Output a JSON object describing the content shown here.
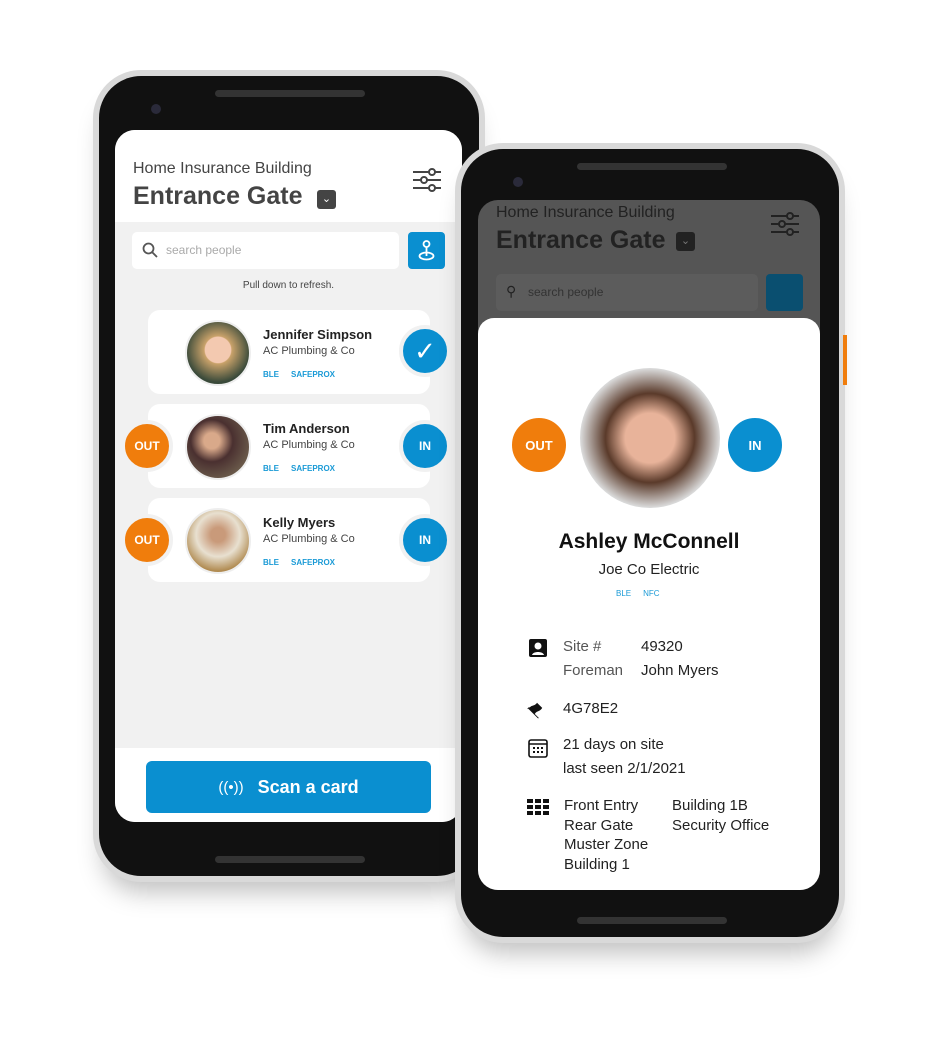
{
  "left_phone": {
    "header": {
      "subtitle": "Home Insurance Building",
      "title": "Entrance Gate"
    },
    "search": {
      "placeholder": "search people"
    },
    "refresh_hint": "Pull down to refresh.",
    "people": [
      {
        "name": "Jennifer Simpson",
        "company": "AC Plumbing & Co",
        "tags": [
          "BLE",
          "SAFEPROX"
        ],
        "status": "checked-in"
      },
      {
        "name": "Tim Anderson",
        "company": "AC Plumbing & Co",
        "tags": [
          "BLE",
          "SAFEPROX"
        ],
        "out_label": "OUT",
        "in_label": "IN"
      },
      {
        "name": "Kelly Myers",
        "company": "AC Plumbing & Co",
        "tags": [
          "BLE",
          "SAFEPROX"
        ],
        "out_label": "OUT",
        "in_label": "IN"
      }
    ],
    "scan_button": "Scan a card"
  },
  "right_phone": {
    "header": {
      "subtitle": "Home Insurance Building",
      "title": "Entrance Gate"
    },
    "search": {
      "placeholder": "search people"
    },
    "detail": {
      "out_label": "OUT",
      "in_label": "IN",
      "name": "Ashley McConnell",
      "company": "Joe Co Electric",
      "tags": [
        "BLE",
        "NFC"
      ],
      "site_label": "Site #",
      "site_value": "49320",
      "foreman_label": "Foreman",
      "foreman_value": "John Myers",
      "tag_id": "4G78E2",
      "days_on_site": "21 days on site",
      "last_seen": "last seen 2/1/2021",
      "zones_col1": [
        "Front Entry",
        "Rear Gate",
        "Muster Zone",
        "Building 1"
      ],
      "zones_col2": [
        "Building 1B",
        "Security Office"
      ]
    }
  },
  "colors": {
    "accent": "#0a8fd0",
    "out": "#f07d0c",
    "background": "#f1f1f1"
  }
}
